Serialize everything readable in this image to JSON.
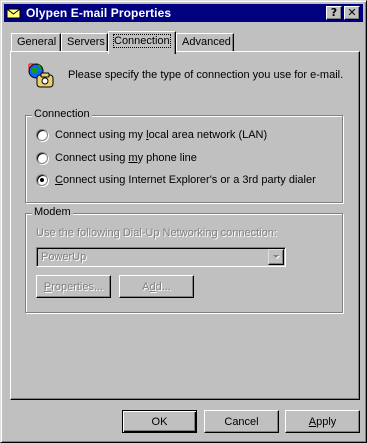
{
  "window": {
    "title": "Olypen E-mail Properties",
    "help_label": "?",
    "close_label": "✕"
  },
  "tabs": [
    {
      "label": "General",
      "active": false
    },
    {
      "label": "Servers",
      "active": false
    },
    {
      "label": "Connection",
      "active": true
    },
    {
      "label": "Advanced",
      "active": false
    }
  ],
  "intro": {
    "icon": "globe-phone-icon",
    "text": "Please specify the type of connection you use for e-mail."
  },
  "connection_group": {
    "label": "Connection",
    "options": [
      {
        "label_pre": "Connect using my ",
        "label_u": "l",
        "label_post": "ocal area network (LAN)",
        "checked": false
      },
      {
        "label_pre": "Connect using ",
        "label_u": "m",
        "label_post": "y phone line",
        "checked": false
      },
      {
        "label_pre": "",
        "label_u": "C",
        "label_post": "onnect using Internet Explorer's or a 3rd party dialer",
        "checked": true
      }
    ]
  },
  "modem_group": {
    "label": "Modem",
    "instruction": "Use the following Dial-Up Networking connection:",
    "combo_value": "PowerUp",
    "properties_pre": "",
    "properties_u": "P",
    "properties_post": "roperties...",
    "add_pre": "A",
    "add_u": "d",
    "add_post": "d...",
    "enabled": false
  },
  "buttons": {
    "ok": "OK",
    "cancel": "Cancel",
    "apply_u": "A",
    "apply_post": "pply"
  },
  "colors": {
    "face": "#c0c0c0",
    "titlebar": "#000080",
    "disabled_text": "#808080"
  }
}
